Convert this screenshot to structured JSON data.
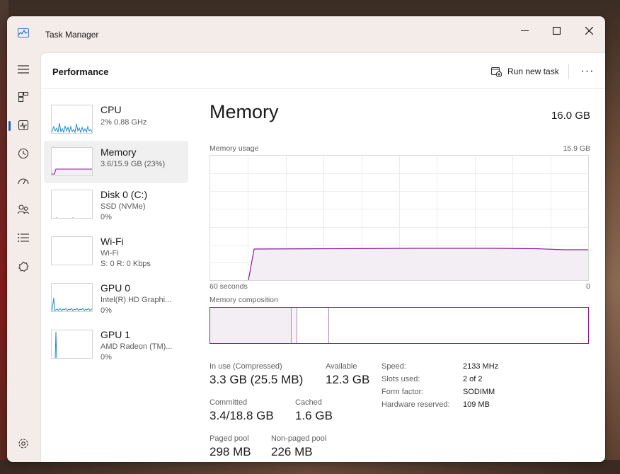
{
  "window": {
    "title": "Task Manager",
    "controls": {
      "minimize": "—",
      "maximize": "☐",
      "close": "✕"
    }
  },
  "header": {
    "title": "Performance",
    "run_new_task": "Run new task",
    "more": "···"
  },
  "sidebar": {
    "items": [
      {
        "icon": "hamburger-icon"
      },
      {
        "icon": "processes-icon"
      },
      {
        "icon": "performance-icon",
        "active": true
      },
      {
        "icon": "app-history-icon"
      },
      {
        "icon": "startup-apps-icon"
      },
      {
        "icon": "users-icon"
      },
      {
        "icon": "details-icon"
      },
      {
        "icon": "services-icon"
      },
      {
        "icon": "settings-icon"
      }
    ]
  },
  "perf_items": [
    {
      "name": "CPU",
      "sub1": "2%  0.88 GHz",
      "sub2": "",
      "color": "#1f8bc7"
    },
    {
      "name": "Memory",
      "sub1": "3.6/15.9 GB (23%)",
      "sub2": "",
      "color": "#8b1e97"
    },
    {
      "name": "Disk 0 (C:)",
      "sub1": "SSD (NVMe)",
      "sub2": "0%",
      "color": "#5f9e1a"
    },
    {
      "name": "Wi-Fi",
      "sub1": "Wi-Fi",
      "sub2": "S: 0 R: 0 Kbps",
      "color": "#a5601c"
    },
    {
      "name": "GPU 0",
      "sub1": "Intel(R) HD Graphi...",
      "sub2": "0%",
      "color": "#1f8bc7"
    },
    {
      "name": "GPU 1",
      "sub1": "AMD Radeon (TM)...",
      "sub2": "0%",
      "color": "#1f8bc7"
    }
  ],
  "memory": {
    "title": "Memory",
    "total": "16.0 GB",
    "usage_label": "Memory usage",
    "usage_max": "15.9 GB",
    "time_left": "60 seconds",
    "time_right": "0",
    "composition_label": "Memory composition",
    "accent": "#8b1e97",
    "fill": "#f2eef4",
    "usage_fraction": 0.25,
    "stats": {
      "in_use_label": "In use (Compressed)",
      "in_use_value": "3.3 GB (25.5 MB)",
      "available_label": "Available",
      "available_value": "12.3 GB",
      "committed_label": "Committed",
      "committed_value": "3.4/18.8 GB",
      "cached_label": "Cached",
      "cached_value": "1.6 GB",
      "paged_label": "Paged pool",
      "paged_value": "298 MB",
      "nonpaged_label": "Non-paged pool",
      "nonpaged_value": "226 MB"
    },
    "specs": [
      {
        "label": "Speed:",
        "value": "2133 MHz"
      },
      {
        "label": "Slots used:",
        "value": "2 of 2"
      },
      {
        "label": "Form factor:",
        "value": "SODIMM"
      },
      {
        "label": "Hardware reserved:",
        "value": "109 MB"
      }
    ]
  }
}
